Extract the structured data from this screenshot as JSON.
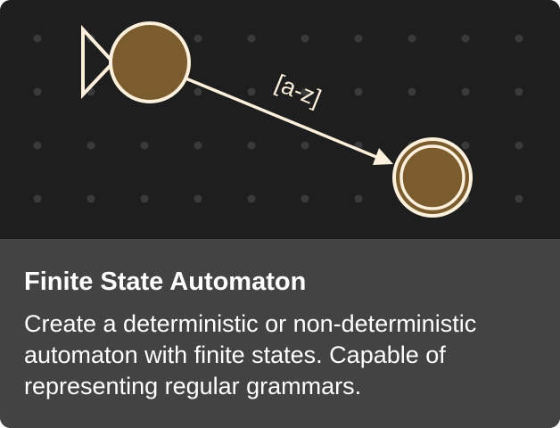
{
  "card": {
    "title": "Finite State Automaton",
    "description": "Create a deterministic or non-deterministic automaton with finite states. Capable of representing regular grammars."
  },
  "diagram": {
    "transition_label": "[a-z]",
    "colors": {
      "background": "#1e1e1e",
      "dot": "#3a3a3a",
      "state_fill": "#7a5c2e",
      "stroke": "#fdf0dc"
    }
  }
}
